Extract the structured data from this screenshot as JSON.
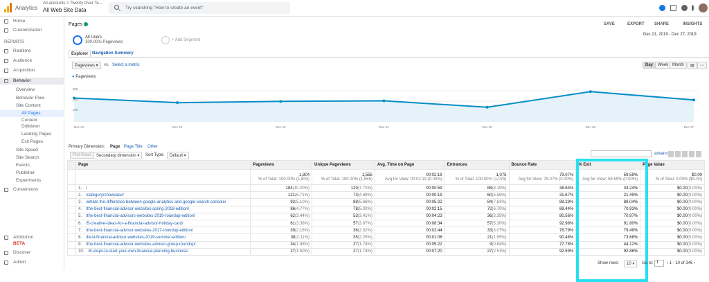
{
  "header": {
    "app": "Analytics",
    "crumbs": "All accounts > Twenty Over Te...",
    "view": "All Web Site Data",
    "search_placeholder": "Try searching \"How to create an event\""
  },
  "sidebar": {
    "home": "Home",
    "custom": "Customization",
    "reports": "REPORTS",
    "realtime": "Realtime",
    "audience": "Audience",
    "acquisition": "Acquisition",
    "behavior": "Behavior",
    "overview": "Overview",
    "flow": "Behavior Flow",
    "site_content": "Site Content",
    "all_pages": "All Pages",
    "content": "Content",
    "drilldown": "Drilldown",
    "landing": "Landing Pages",
    "exit": "Exit Pages",
    "speed": "Site Speed",
    "site_search": "Site Search",
    "events": "Events",
    "publisher": "Publisher",
    "experiments": "Experiments",
    "conversions": "Conversions",
    "attribution": "Attribution",
    "beta": "BETA",
    "discover": "Discover",
    "admin": "Admin"
  },
  "report": {
    "title": "Pages",
    "save": "SAVE",
    "export": "EXPORT",
    "share": "SHARE",
    "insights": "INSIGHTS",
    "date": "Dec 21, 2019 - Dec 27, 2019",
    "segment": "All Users",
    "segment_sub": "100.00% Pageviews",
    "add_segment": "+ Add Segment",
    "tab_explorer": "Explorer",
    "tab_nav": "Navigation Summary",
    "metric": "Pageviews",
    "vs": "vs.",
    "select_metric": "Select a metric",
    "day": "Day",
    "week": "Week",
    "month": "Month",
    "legend": "Pageviews",
    "primary": "Primary Dimension:",
    "dim_page": "Page",
    "dim_title": "Page Title",
    "dim_other": "Other",
    "plot_rows": "Plot Rows",
    "secondary": "Secondary dimension",
    "sort": "Sort Type:",
    "default": "Default",
    "advanced": "advanced",
    "show_rows": "Show rows:",
    "rows_val": "10",
    "goto": "Go to:",
    "goto_val": "1",
    "range": "1 - 10 of 346"
  },
  "chart_data": {
    "type": "line",
    "series": [
      {
        "name": "Pageviews",
        "values": [
          280,
          255,
          262,
          265,
          230,
          315,
          270
        ]
      }
    ],
    "x": [
      "Dec 21",
      "Dec 22",
      "Dec 23",
      "Dec 24",
      "Dec 25",
      "Dec 26",
      "Dec 27"
    ],
    "ylim": [
      150,
      350
    ],
    "ticks": [
      "300",
      "200",
      "100"
    ]
  },
  "columns": [
    "Page",
    "Pageviews",
    "Unique Pageviews",
    "Avg. Time on Page",
    "Entrances",
    "Bounce Rate",
    "% Exit",
    "Page Value"
  ],
  "totals": [
    "1,804",
    "% of Total: 100.00% (1,804)",
    "1,555",
    "% of Total: 100.00% (1,555)",
    "00:02:19",
    "Avg for View: 00:02:19 (0.00%)",
    "1,075",
    "% of Total: 100.00% (1,075)",
    "79.07%",
    "Avg for View: 79.07% (0.00%)",
    "59.59%",
    "Avg for View: 59.59% (0.00%)",
    "$0.00",
    "% of Total: 0.00% ($0.00)"
  ],
  "rows": [
    [
      "1.",
      "/",
      "184",
      "(10.20%)",
      "120",
      "(7.72%)",
      "00:00:59",
      "88",
      "(8.19%)",
      "38.64%",
      "34.24%",
      "$0.00",
      "(0.00%)"
    ],
    [
      "2.",
      "/category/showcase/",
      "121",
      "(6.71%)",
      "73",
      "(4.69%)",
      "00:00:19",
      "60",
      "(5.58%)",
      "31.67%",
      "21.49%",
      "$0.00",
      "(0.00%)"
    ],
    [
      "3.",
      "/whats-the-difference-between-google-analytics-and-google-search-console/",
      "92",
      "(5.10%)",
      "88",
      "(5.66%)",
      "00:05:22",
      "84",
      "(7.81%)",
      "89.29%",
      "88.04%",
      "$0.00",
      "(0.00%)"
    ],
    [
      "4.",
      "/the-best-financial-advisor-websites-spring-2018-edition/",
      "86",
      "(4.77%)",
      "78",
      "(5.02%)",
      "00:02:15",
      "72",
      "(6.70%)",
      "69.44%",
      "70.93%",
      "$0.00",
      "(0.00%)"
    ],
    [
      "5.",
      "/the-best-financial-advisors-websites-2019-roundup-edition/",
      "62",
      "(3.44%)",
      "53",
      "(3.41%)",
      "00:04:23",
      "36",
      "(3.35%)",
      "80.56%",
      "70.97%",
      "$0.00",
      "(0.00%)"
    ],
    [
      "6.",
      "/5-creative-ideas-for-a-financial-advisor-holiday-card/",
      "61",
      "(3.38%)",
      "57",
      "(3.67%)",
      "00:08:34",
      "57",
      "(5.30%)",
      "92.98%",
      "91.80%",
      "$0.00",
      "(0.00%)"
    ],
    [
      "7.",
      "/the-best-financial-advisor-websites-2017-roundup-edition/",
      "39",
      "(2.16%)",
      "36",
      "(2.32%)",
      "00:02:44",
      "33",
      "(3.07%)",
      "78.79%",
      "79.49%",
      "$0.00",
      "(0.00%)"
    ],
    [
      "8.",
      "/best-financial-advisor-websites-2019-summer-edition/",
      "38",
      "(2.11%)",
      "35",
      "(2.25%)",
      "00:01:06",
      "21",
      "(1.95%)",
      "90.48%",
      "73.68%",
      "$0.00",
      "(0.00%)"
    ],
    [
      "9.",
      "/the-best-financial-advisor-websites-advisor-group-roundup/",
      "34",
      "(1.88%)",
      "27",
      "(1.74%)",
      "00:05:22",
      "9",
      "(0.84%)",
      "77.78%",
      "44.12%",
      "$0.00",
      "(0.00%)"
    ],
    [
      "10.",
      "/6-steps-to-start-your-own-financial-planning-business/",
      "27",
      "(1.50%)",
      "27",
      "(1.74%)",
      "00:07:20",
      "27",
      "(2.51%)",
      "92.59%",
      "92.86%",
      "$0.00",
      "(0.00%)"
    ]
  ]
}
